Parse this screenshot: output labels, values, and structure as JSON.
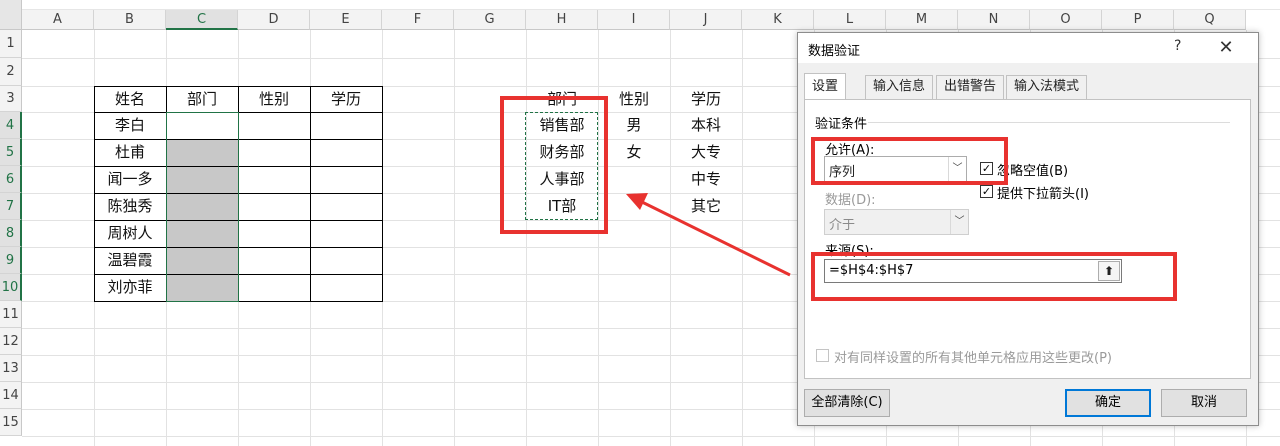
{
  "sheet": {
    "columns": [
      "A",
      "B",
      "C",
      "D",
      "E",
      "F",
      "G",
      "H",
      "I",
      "J",
      "K",
      "L",
      "M",
      "N",
      "O",
      "P",
      "Q"
    ],
    "rows": [
      "1",
      "2",
      "3",
      "4",
      "5",
      "6",
      "7",
      "8",
      "9",
      "10",
      "11",
      "12",
      "13",
      "14",
      "15"
    ],
    "selected_column": "C",
    "selected_rows": [
      "4",
      "5",
      "6",
      "7",
      "8",
      "9",
      "10"
    ],
    "main_table": {
      "headers": [
        "姓名",
        "部门",
        "性别",
        "学历"
      ],
      "names": [
        "李白",
        "杜甫",
        "闻一多",
        "陈独秀",
        "周树人",
        "温碧霞",
        "刘亦菲"
      ]
    },
    "ref_table": {
      "headers": [
        "部门",
        "性别",
        "学历"
      ],
      "departments": [
        "销售部",
        "财务部",
        "人事部",
        "IT部"
      ],
      "genders": [
        "男",
        "女"
      ],
      "education": [
        "本科",
        "大专",
        "中专",
        "其它"
      ]
    },
    "colors": {
      "highlight_red": "#e8322f",
      "selection_green": "#217346",
      "gray_fill": "#c8c8c8"
    }
  },
  "dialog": {
    "title": "数据验证",
    "help": "?",
    "close_icon": "close-icon",
    "tabs": [
      "设置",
      "输入信息",
      "出错警告",
      "输入法模式"
    ],
    "active_tab": "设置",
    "group_label": "验证条件",
    "allow_label": "允许(A):",
    "allow_value": "序列",
    "ignore_blank_label": "忽略空值(B)",
    "ignore_blank_checked": true,
    "dropdown_arrow_label": "提供下拉箭头(I)",
    "dropdown_arrow_checked": true,
    "data_label": "数据(D):",
    "data_value": "介于",
    "source_label": "来源(S):",
    "source_value": "=$H$4:$H$7",
    "apply_all_label": "对有同样设置的所有其他单元格应用这些更改(P)",
    "apply_all_checked": false,
    "clear_all": "全部清除(C)",
    "ok": "确定",
    "cancel": "取消",
    "check_mark": "✓"
  }
}
